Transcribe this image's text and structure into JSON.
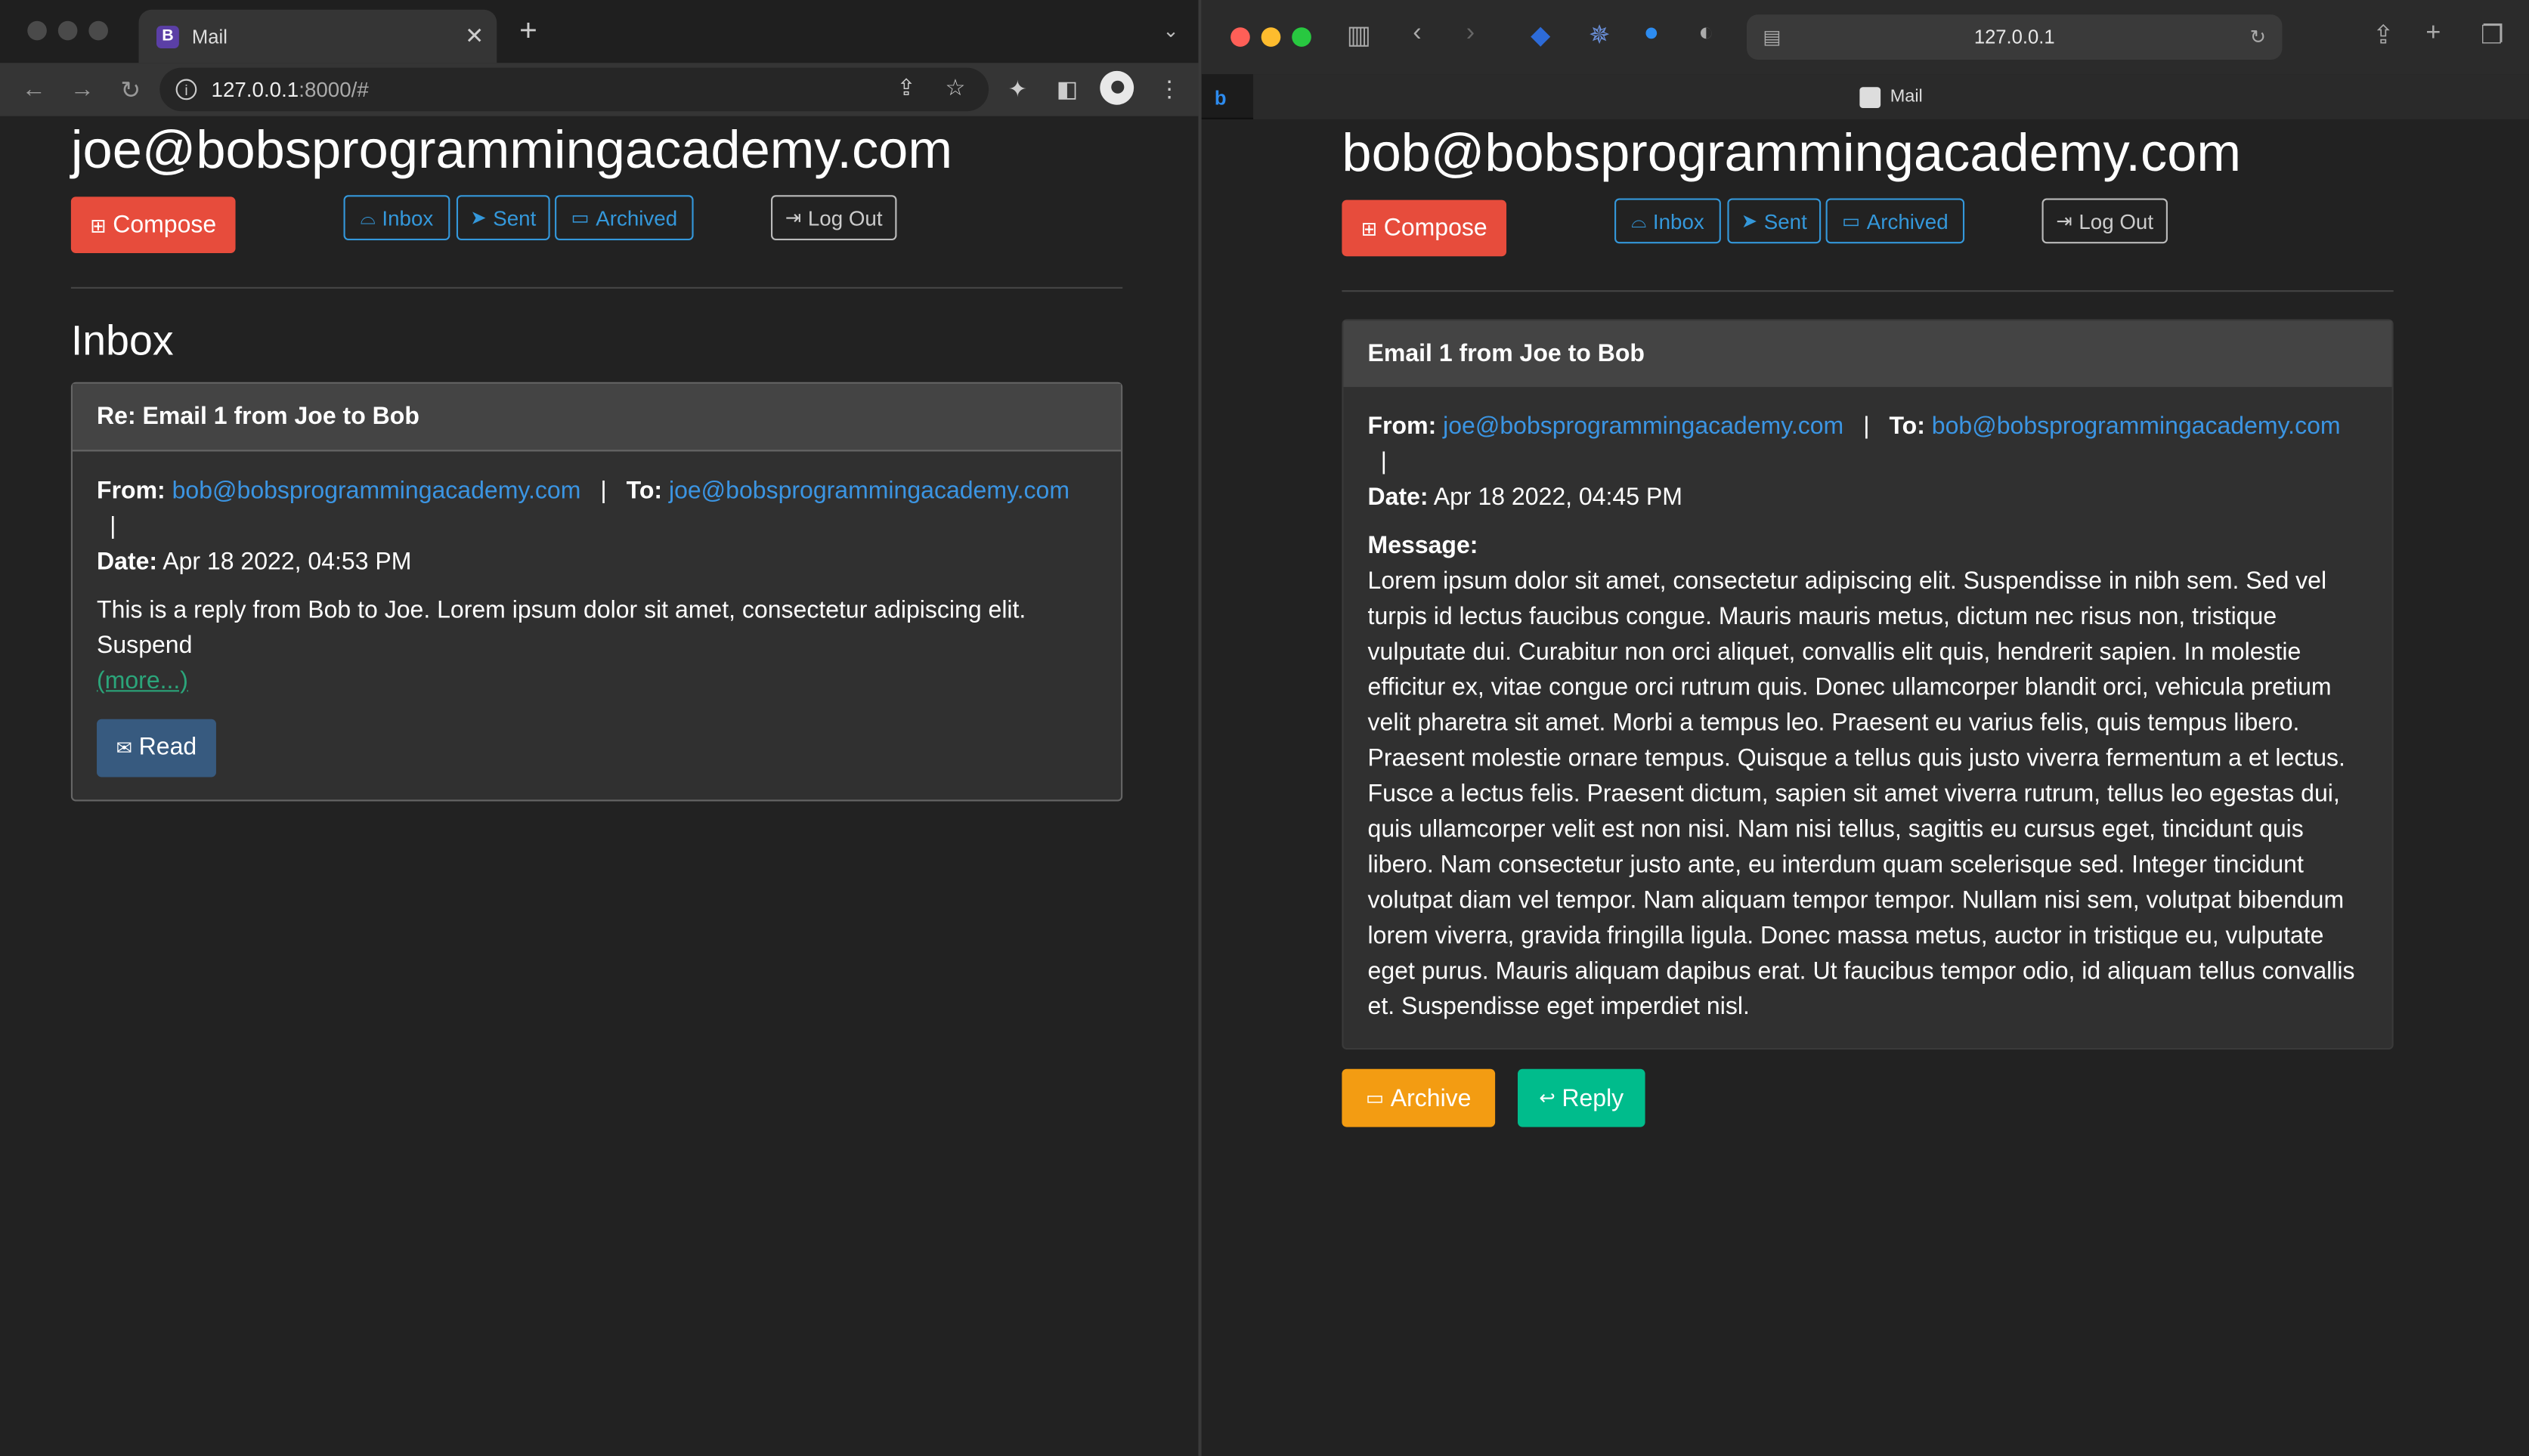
{
  "left_browser": {
    "tab_title": "Mail",
    "tab_icon_letter": "B",
    "url_host": "127.0.0.1",
    "url_rest": ":8000/#"
  },
  "left_page": {
    "user_email": "joe@bobsprogrammingacademy.com",
    "compose_label": "Compose",
    "nav": {
      "inbox": "Inbox",
      "sent": "Sent",
      "archived": "Archived",
      "logout": "Log Out"
    },
    "section_title": "Inbox",
    "email_card": {
      "subject": "Re: Email 1 from Joe to Bob",
      "from_label": "From:",
      "from": "bob@bobsprogrammingacademy.com",
      "to_label": "To:",
      "to": "joe@bobsprogrammingacademy.com",
      "date_label": "Date:",
      "date": "Apr 18 2022, 04:53 PM",
      "preview": "This is a reply from Bob to Joe. Lorem ipsum dolor sit amet, consectetur adipiscing elit. Suspend",
      "more_label": "(more...)",
      "read_label": "Read"
    }
  },
  "right_browser": {
    "address": "127.0.0.1",
    "tab_title": "Mail"
  },
  "right_page": {
    "user_email": "bob@bobsprogrammingacademy.com",
    "compose_label": "Compose",
    "nav": {
      "inbox": "Inbox",
      "sent": "Sent",
      "archived": "Archived",
      "logout": "Log Out"
    },
    "email_view": {
      "subject": "Email 1 from Joe to Bob",
      "from_label": "From:",
      "from": "joe@bobsprogrammingacademy.com",
      "to_label": "To:",
      "to": "bob@bobsprogrammingacademy.com",
      "date_label": "Date:",
      "date": "Apr 18 2022, 04:45 PM",
      "message_label": "Message:",
      "message": "Lorem ipsum dolor sit amet, consectetur adipiscing elit. Suspendisse in nibh sem. Sed vel turpis id lectus faucibus congue. Mauris mauris metus, dictum nec risus non, tristique vulputate dui. Curabitur non orci aliquet, convallis elit quis, hendrerit sapien. In molestie efficitur ex, vitae congue orci rutrum quis. Donec ullamcorper blandit orci, vehicula pretium velit pharetra sit amet. Morbi a tempus leo. Praesent eu varius felis, quis tempus libero. Praesent molestie ornare tempus. Quisque a tellus quis justo viverra fermentum a et lectus. Fusce a lectus felis. Praesent dictum, sapien sit amet viverra rutrum, tellus leo egestas dui, quis ullamcorper velit est non nisi. Nam nisi tellus, sagittis eu cursus eget, tincidunt quis libero. Nam consectetur justo ante, eu interdum quam scelerisque sed. Integer tincidunt volutpat diam vel tempor. Nam aliquam tempor tempor. Nullam nisi sem, volutpat bibendum lorem viverra, gravida fringilla ligula. Donec massa metus, auctor in tristique eu, vulputate eget purus. Mauris aliquam dapibus erat. Ut faucibus tempor odio, id aliquam tellus convallis et. Suspendisse eget imperdiet nisl.",
      "archive_label": "Archive",
      "reply_label": "Reply"
    }
  },
  "colors": {
    "page_bg": "#222222",
    "compose": "#e74c3c",
    "link": "#3b95e3",
    "outline_btn": "#3498db",
    "read_btn": "#375a7f",
    "archive_btn": "#f39c12",
    "reply_btn": "#00bc8c",
    "traffic_red": "#ff5f57",
    "traffic_yellow": "#febc2e",
    "traffic_green": "#28c840"
  }
}
